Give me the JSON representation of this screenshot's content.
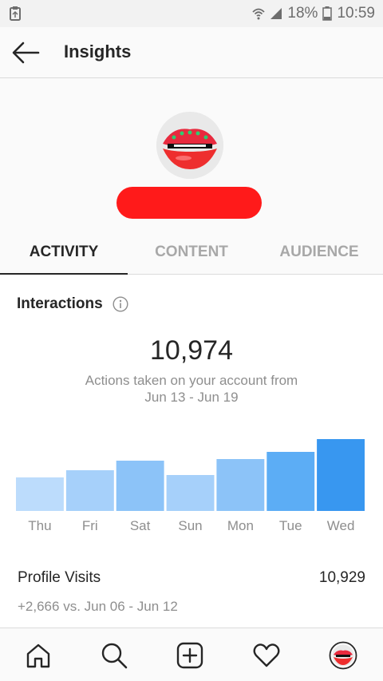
{
  "status_bar": {
    "battery": "18%",
    "time": "10:59"
  },
  "header": {
    "title": "Insights"
  },
  "tabs": [
    {
      "label": "ACTIVITY",
      "active": true
    },
    {
      "label": "CONTENT",
      "active": false
    },
    {
      "label": "AUDIENCE",
      "active": false
    }
  ],
  "interactions": {
    "title": "Interactions",
    "total": "10,974",
    "description_line1": "Actions taken on your account from",
    "description_line2": "Jun 13 - Jun 19"
  },
  "chart_data": {
    "type": "bar",
    "categories": [
      "Thu",
      "Fri",
      "Sat",
      "Sun",
      "Mon",
      "Tue",
      "Wed"
    ],
    "values": [
      42,
      51,
      63,
      45,
      65,
      74,
      90
    ],
    "ylim": [
      0,
      100
    ],
    "colors": [
      "#bcdcfc",
      "#a6d0fa",
      "#8cc3f8",
      "#a6d0fa",
      "#8cc3f8",
      "#5cadf5",
      "#3897f0"
    ],
    "label_color": "#8e8e8e"
  },
  "profile_visits": {
    "label": "Profile Visits",
    "value": "10,929",
    "comparison": "+2,666 vs. Jun 06 - Jun 12"
  },
  "icons": {
    "back": "arrow-left-icon",
    "info": "info-icon",
    "nav": [
      "home-icon",
      "search-icon",
      "add-post-icon",
      "heart-icon",
      "profile-avatar"
    ]
  }
}
